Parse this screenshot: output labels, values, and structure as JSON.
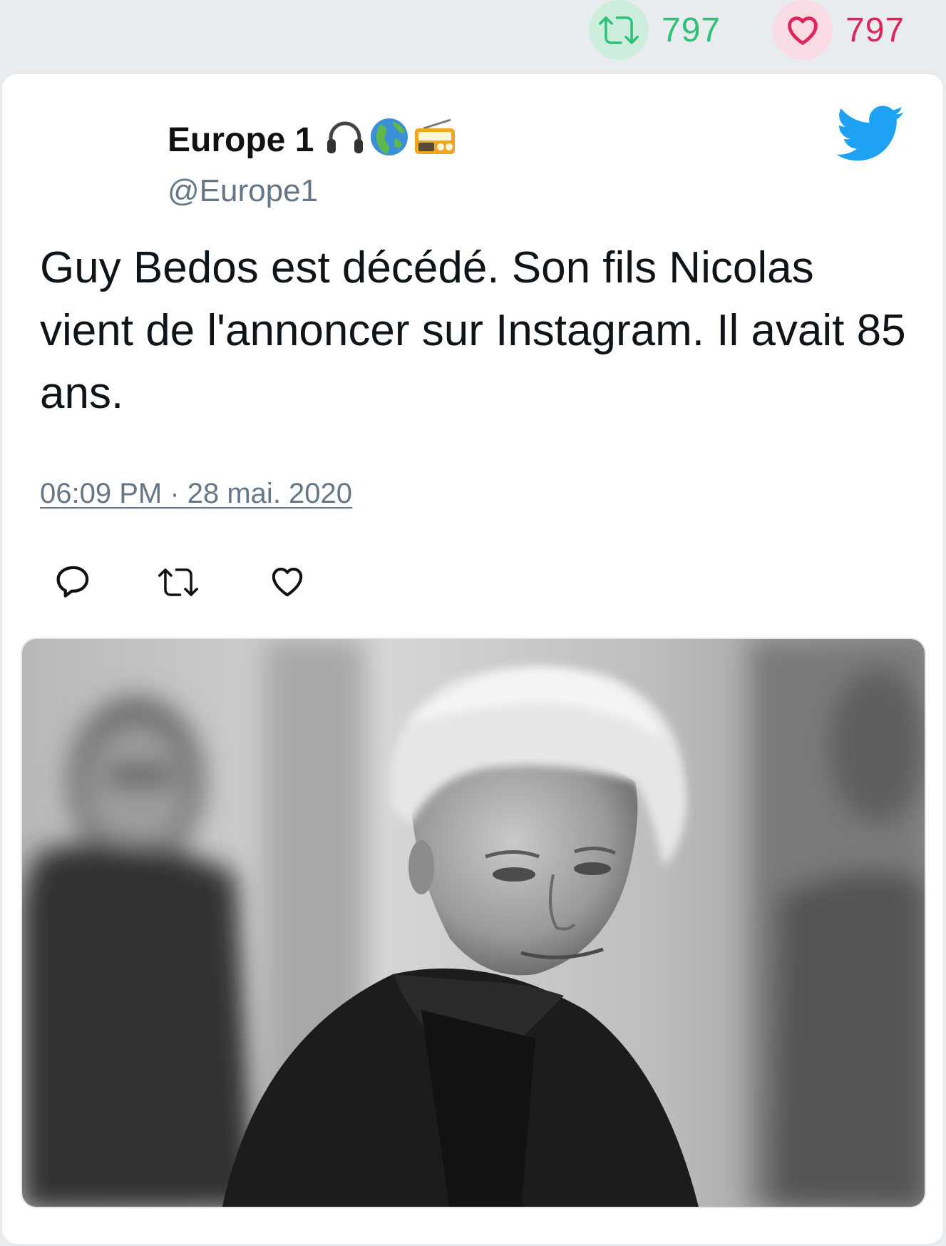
{
  "stats": {
    "retweets": "797",
    "likes": "797",
    "colors": {
      "retweet": "#2fc17a",
      "like": "#e0245e"
    }
  },
  "tweet": {
    "author_name": "Europe 1",
    "author_emojis": [
      "headphones-emoji",
      "globe-emoji",
      "radio-emoji"
    ],
    "handle": "@Europe1",
    "text": "Guy Bedos est décédé. Son fils Nicolas vient de l'annoncer sur Instagram. Il avait 85 ans.",
    "timestamp": "06:09 PM · 28 mai. 2020",
    "actions": [
      "reply-icon",
      "retweet-icon",
      "like-icon"
    ],
    "brand_color": "#1da1f2"
  },
  "media": {
    "kind": "black-and-white portrait photo"
  }
}
